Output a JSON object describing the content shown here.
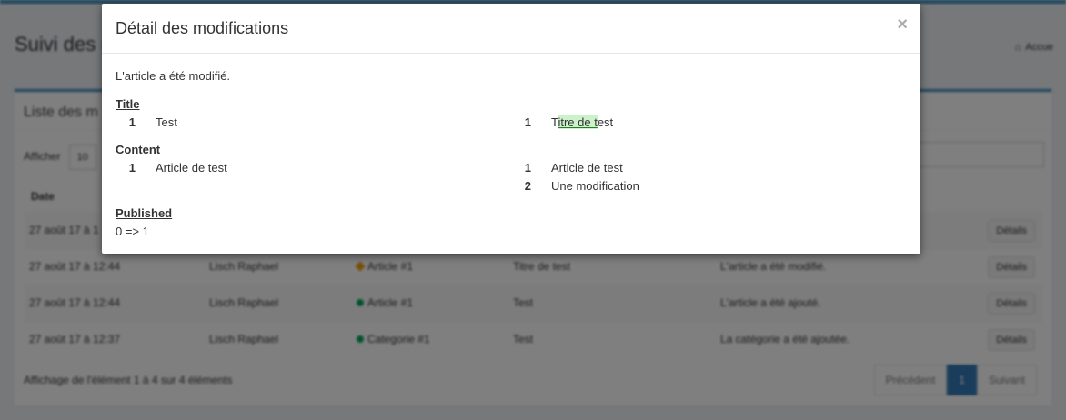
{
  "background": {
    "page_title": "Suivi des m",
    "breadcrumb": "Accue",
    "box_title": "Liste des m",
    "length_label": "Afficher",
    "length_value": "10",
    "column_date": "Date",
    "rows": [
      {
        "date": "27 août 17 à 1",
        "user": "",
        "item": "",
        "title": "",
        "desc": "",
        "details": "Détails"
      },
      {
        "date": "27 août 17 à 12:44",
        "user": "Lisch Raphael",
        "item": "Article #1",
        "title": "Titre de test",
        "desc": "L'article a été modifié.",
        "details": "Détails",
        "kind": "edit"
      },
      {
        "date": "27 août 17 à 12:44",
        "user": "Lisch Raphael",
        "item": "Article #1",
        "title": "Test",
        "desc": "L'article a été ajouté.",
        "details": "Détails",
        "kind": "add"
      },
      {
        "date": "27 août 17 à 12:37",
        "user": "Lisch Raphael",
        "item": "Categorie #1",
        "title": "Test",
        "desc": "La catégorie a été ajoutée.",
        "details": "Détails",
        "kind": "add"
      }
    ],
    "info": "Affichage de l'élément 1 à 4 sur 4 éléments",
    "pager": {
      "prev": "Précédent",
      "current": "1",
      "next": "Suivant"
    },
    "colors": {
      "primary": "#3c8dbc",
      "added": "#00a65a",
      "edited": "#f39c12"
    }
  },
  "modal": {
    "title": "Détail des modifications",
    "close": "×",
    "summary": "L'article a été modifié.",
    "sections": {
      "title": {
        "label": "Title",
        "old": {
          "num": "1",
          "text": "Test"
        },
        "new": {
          "num": "1",
          "pre": "T",
          "highlight": "itre de t",
          "post": "est"
        }
      },
      "content": {
        "label": "Content",
        "old": {
          "num": "1",
          "text": "Article de test"
        },
        "new": [
          {
            "num": "1",
            "text": "Article de test"
          },
          {
            "num": "2",
            "text": "Une modification"
          }
        ]
      },
      "published": {
        "label": "Published",
        "value": "0 => 1"
      }
    },
    "highlight_color": "#ccf2cc"
  }
}
